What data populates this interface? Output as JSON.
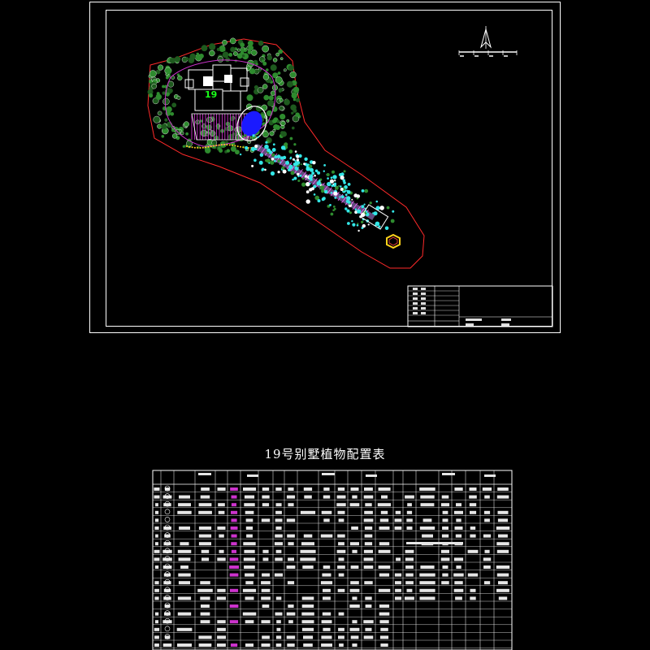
{
  "plan": {
    "villa_number": "19",
    "north_symbol": "north-arrow",
    "colors": {
      "background": "#000000",
      "tree_fill": "#2e8b2e",
      "tree_stroke": "#ffffff",
      "boundary": "#ff2a2a",
      "building": "#ffffff",
      "pond": "#1a1aff",
      "path_magenta": "#cc33cc",
      "shrub_cyan": "#33e6e6",
      "hedge_yellow": "#ffd21a"
    }
  },
  "table": {
    "title": "19号别墅植物配置表"
  }
}
